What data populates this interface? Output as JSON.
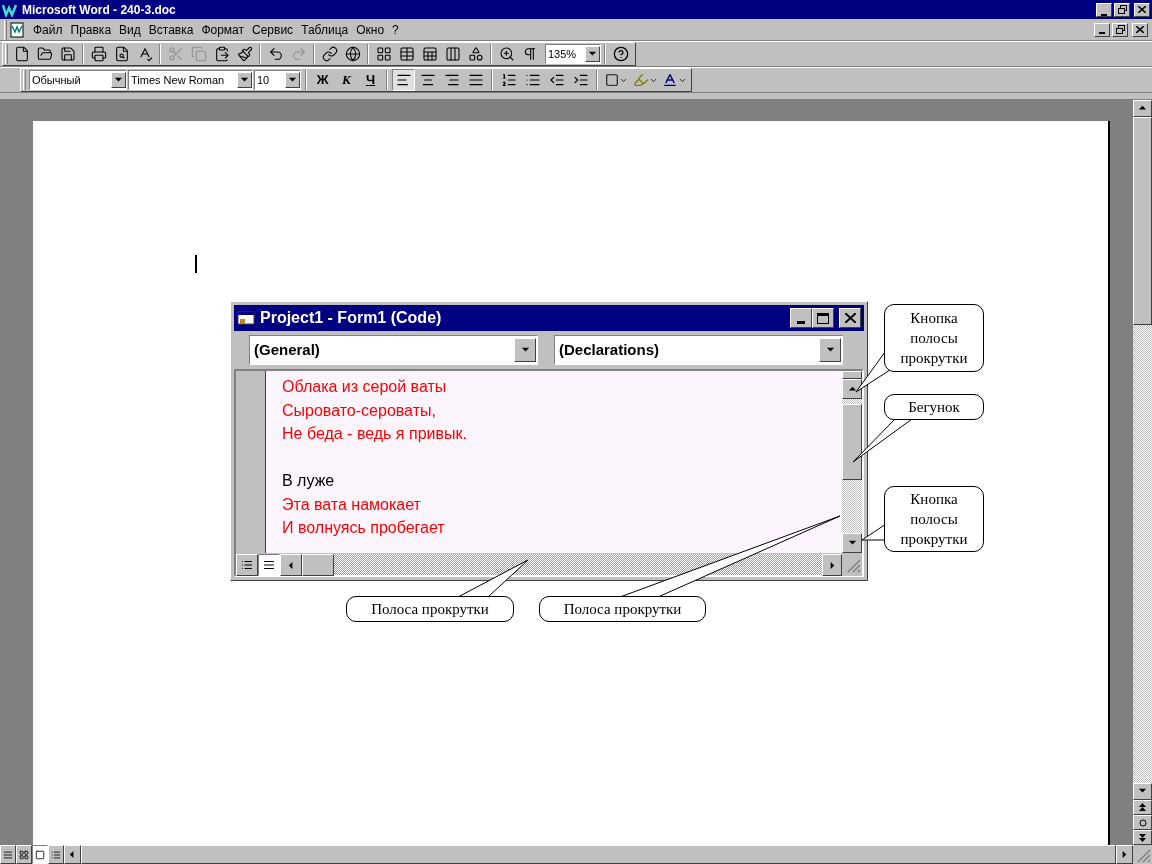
{
  "window": {
    "title": "Microsoft Word - 240-3.doc"
  },
  "menu": [
    "Файл",
    "Правка",
    "Вид",
    "Вставка",
    "Формат",
    "Сервис",
    "Таблица",
    "Окно",
    "?"
  ],
  "standard_toolbar": {
    "buttons": [
      {
        "kind": "new",
        "disabled": false
      },
      {
        "kind": "open",
        "disabled": false
      },
      {
        "kind": "save",
        "disabled": false
      },
      {
        "kind": "sep"
      },
      {
        "kind": "print",
        "disabled": false
      },
      {
        "kind": "preview",
        "disabled": false
      },
      {
        "kind": "spelling",
        "disabled": false
      },
      {
        "kind": "sep"
      },
      {
        "kind": "cut",
        "disabled": true
      },
      {
        "kind": "copy",
        "disabled": true
      },
      {
        "kind": "paste",
        "disabled": false
      },
      {
        "kind": "brush",
        "disabled": false
      },
      {
        "kind": "sep"
      },
      {
        "kind": "undo",
        "disabled": false
      },
      {
        "kind": "redo",
        "disabled": true
      },
      {
        "kind": "sep"
      },
      {
        "kind": "link",
        "disabled": false
      },
      {
        "kind": "globe",
        "disabled": false
      },
      {
        "kind": "sep"
      },
      {
        "kind": "tables",
        "disabled": false
      },
      {
        "kind": "table",
        "disabled": false
      },
      {
        "kind": "sheet",
        "disabled": false
      },
      {
        "kind": "columns",
        "disabled": false
      },
      {
        "kind": "drawing",
        "disabled": false
      },
      {
        "kind": "sep"
      },
      {
        "kind": "map",
        "disabled": false
      },
      {
        "kind": "pilcrow",
        "disabled": false
      }
    ],
    "zoom": "135%"
  },
  "formatting_toolbar": {
    "style": "Обычный",
    "font": "Times New Roman",
    "size": "10",
    "bold": "Ж",
    "italic": "К",
    "underline": "Ч",
    "buttons": [
      {
        "kind": "left",
        "selected": true
      },
      {
        "kind": "center",
        "selected": false
      },
      {
        "kind": "right",
        "selected": false
      },
      {
        "kind": "justify",
        "selected": false
      },
      {
        "kind": "sep"
      },
      {
        "kind": "numbers",
        "selected": false
      },
      {
        "kind": "bullets",
        "selected": false
      },
      {
        "kind": "outdent",
        "selected": false
      },
      {
        "kind": "indent",
        "selected": false
      }
    ]
  },
  "code_window": {
    "title": "Project1 - Form1 (Code)",
    "object": "(General)",
    "procedure": "(Declarations)",
    "stanzas": [
      {
        "lines": [
          {
            "text": "Облака из серой ваты",
            "color": "#ff0000"
          },
          {
            "text": "Сыровато-сероваты,",
            "color": "#ff0000"
          },
          {
            "text": "Не беда - ведь я привык.",
            "color": "#ff0000"
          }
        ]
      },
      {
        "lines": [
          {
            "text": "В луже",
            "color": "#000000"
          },
          {
            "text": "Эта вата намокает",
            "color": "#ff0000"
          },
          {
            "text": "И волнуясь пробегает",
            "color": "#ff0000"
          }
        ]
      }
    ],
    "full_module_view": true
  },
  "callouts": [
    "Кнопка полосы прокрутки",
    "Бегунок",
    "Кнопка полосы прокрутки",
    "Полоса прокрутки",
    "Полоса прокрутки"
  ],
  "view_buttons": [
    {
      "kind": "normal",
      "selected": false
    },
    {
      "kind": "web",
      "selected": false
    },
    {
      "kind": "page",
      "selected": true
    },
    {
      "kind": "outline",
      "selected": false
    }
  ]
}
